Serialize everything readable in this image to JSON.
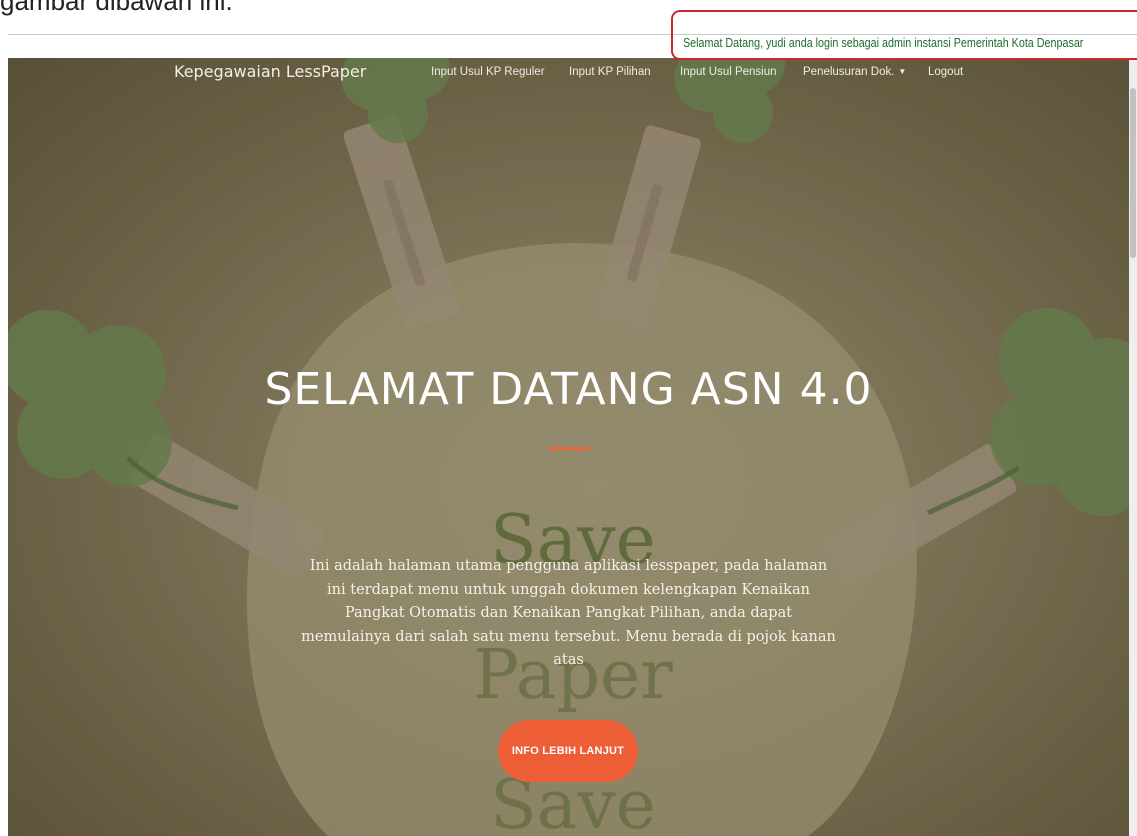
{
  "document": {
    "caption": "gambar dibawah ini."
  },
  "alert": {
    "welcome_text": "Selamat Datang, yudi anda login sebagai admin instansi Pemerintah Kota Denpasar",
    "highlight_color": "#c9282f"
  },
  "navbar": {
    "brand": "Kepegawaian LessPaper",
    "items": [
      {
        "label": "Input Usul KP Reguler"
      },
      {
        "label": "Input KP Pilihan"
      },
      {
        "label": "Input Usul Pensiun"
      },
      {
        "label": "Penelusuran Dok."
      },
      {
        "label": "Logout"
      }
    ],
    "dropdown_icon": "caret-down-icon"
  },
  "hero": {
    "title": "SELAMAT DATANG ASN 4.0",
    "description": "Ini adalah halaman utama pengguna aplikasi lesspaper, pada halaman ini terdapat menu untuk unggah dokumen kelengkapan Kenaikan Pangkat Otomatis dan Kenaikan Pangkat Pilihan, anda dapat memulainya dari salah satu menu tersebut. Menu berada di pojok kanan atas",
    "cta_label": "INFO LEBIH LANJUT",
    "accent_color": "#ee5e36",
    "background_word": "Save"
  }
}
